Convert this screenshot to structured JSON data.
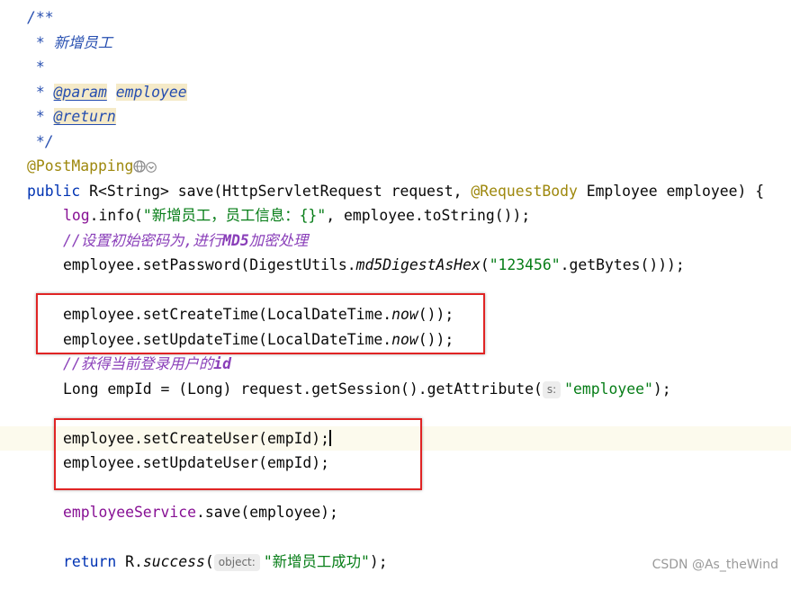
{
  "code": {
    "l1": "/**",
    "l2": " * 新增员工",
    "l3": " *",
    "l4_star": " * ",
    "l4_tag": "@param",
    "l4_sp": " ",
    "l4_param": "employee",
    "l5_star": " * ",
    "l5_tag": "@return",
    "l6": " */",
    "l7_anno": "@PostMapping",
    "l8_kw": "public ",
    "l8_a": "R<String> save(HttpServletRequest request, ",
    "l8_anno": "@RequestBody",
    "l8_b": " Employee employee) {",
    "l9_field": "log",
    "l9_a": ".info(",
    "l9_str": "\"新增员工，员工信息：{}\"",
    "l9_b": ", employee.toString());",
    "l10_prefix": "//设置初始密码为,进行",
    "l10_bold": "MD5",
    "l10_suffix": "加密处理",
    "l11_a": "employee.setPassword(DigestUtils.",
    "l11_it": "md5DigestAsHex",
    "l11_b": "(",
    "l11_str": "\"123456\"",
    "l11_c": ".getBytes()));",
    "l13_a": "employee.setCreateTime(LocalDateTime.",
    "l13_it": "now",
    "l13_b": "());",
    "l14_a": "employee.setUpdateTime(LocalDateTime.",
    "l14_it": "now",
    "l14_b": "());",
    "l15_prefix": "//获得当前登录用户的",
    "l15_bold": "id",
    "l16_a": "Long empId = (Long) request.getSession().getAttribute(",
    "l16_hint": "s:",
    "l16_str": "\"employee\"",
    "l16_b": ");",
    "l18": "employee.setCreateUser(empId);",
    "l19": "employee.setUpdateUser(empId);",
    "l21_field": "employeeService",
    "l21_a": ".save(employee);",
    "l23_kw": "return ",
    "l23_a": "R.",
    "l23_it": "success",
    "l23_b": "(",
    "l23_hint": "object:",
    "l23_str": "\"新增员工成功\"",
    "l23_c": ");"
  },
  "watermark": "CSDN @As_theWind",
  "colors": {
    "highlight_box": "#e02424",
    "string": "#067d17",
    "keyword": "#0033b3",
    "annotation": "#9e880d"
  },
  "icons": {
    "mapping": "globe-icon",
    "expand": "chevron-down-icon"
  }
}
